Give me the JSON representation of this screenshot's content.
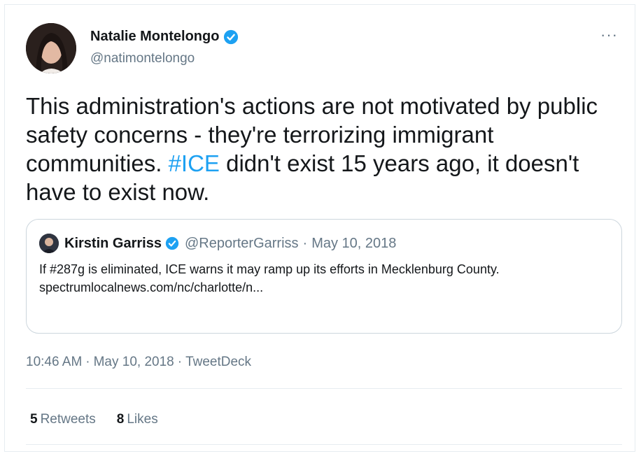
{
  "tweet": {
    "author_name": "Natalie Montelongo",
    "author_handle": "@natimontelongo",
    "more_label": "···",
    "text_part1": "This administration's actions are not motivated by public safety concerns - they're terrorizing immigrant communities. ",
    "hashtag": "#ICE",
    "text_part2": " didn't exist 15 years ago, it doesn't have to exist now.",
    "time": "10:46 AM",
    "date": "May 10, 2018",
    "source": "TweetDeck",
    "separator": "·"
  },
  "quoted": {
    "author_name": "Kirstin Garriss",
    "author_handle": "@ReporterGarriss",
    "separator": "·",
    "date": "May 10, 2018",
    "text": "If #287g is eliminated, ICE warns it may ramp up its efforts in Mecklenburg County.",
    "link": "spectrumlocalnews.com/nc/charlotte/n..."
  },
  "stats": {
    "retweets_count": "5",
    "retweets_label": "Retweets",
    "likes_count": "8",
    "likes_label": "Likes"
  },
  "colors": {
    "accent": "#1da1f2",
    "secondary_text": "#657786",
    "border": "#ccd6dd"
  },
  "icons": [
    "verified-badge-icon",
    "more-options-icon",
    "avatar-image"
  ]
}
